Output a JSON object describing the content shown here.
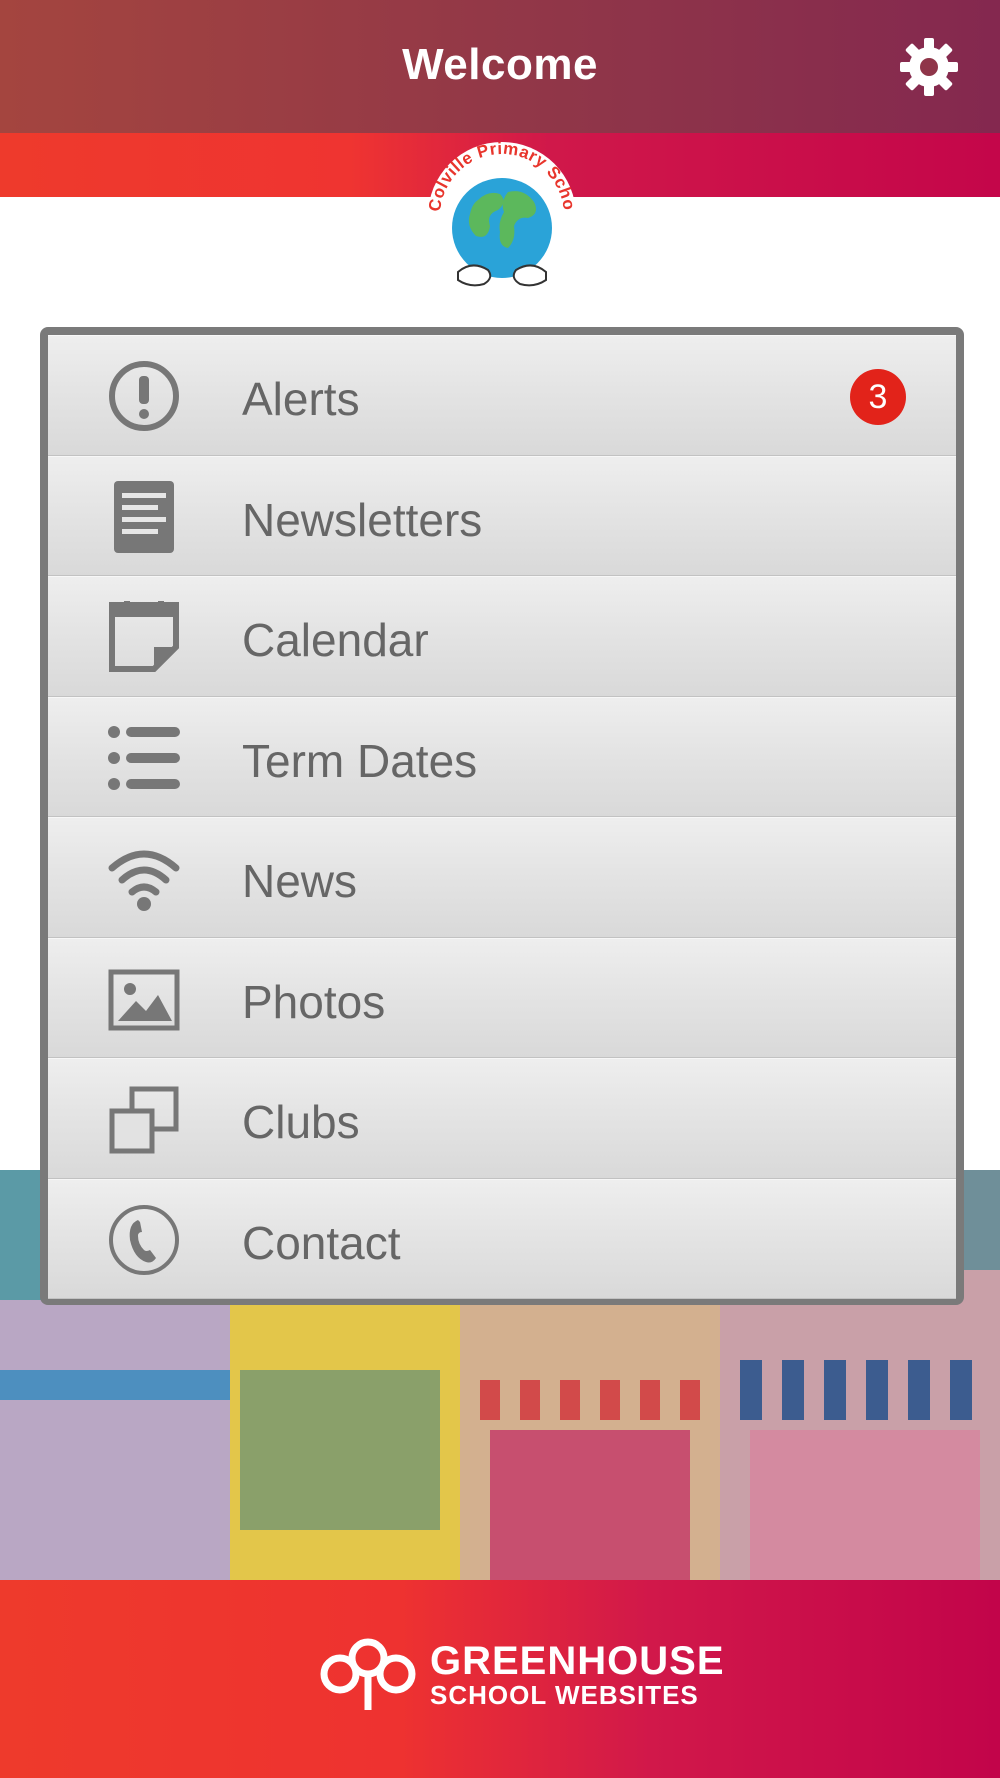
{
  "header": {
    "title": "Welcome",
    "settings_icon": "gear-icon"
  },
  "logo": {
    "school_name": "Colville Primary School"
  },
  "menu": {
    "items": [
      {
        "label": "Alerts",
        "icon": "alert-icon",
        "badge": "3"
      },
      {
        "label": "Newsletters",
        "icon": "document-icon"
      },
      {
        "label": "Calendar",
        "icon": "calendar-icon"
      },
      {
        "label": "Term Dates",
        "icon": "list-icon"
      },
      {
        "label": "News",
        "icon": "wifi-icon"
      },
      {
        "label": "Photos",
        "icon": "image-icon"
      },
      {
        "label": "Clubs",
        "icon": "clubs-icon"
      },
      {
        "label": "Contact",
        "icon": "phone-icon"
      }
    ]
  },
  "footer": {
    "brand_line1": "GREENHOUSE",
    "brand_line2": "SCHOOL WEBSITES"
  },
  "colors": {
    "header": "#8f3549",
    "accent_red": "#ef3431",
    "accent_crimson": "#c4064a",
    "badge": "#e2231a",
    "menu_text": "#666666"
  }
}
